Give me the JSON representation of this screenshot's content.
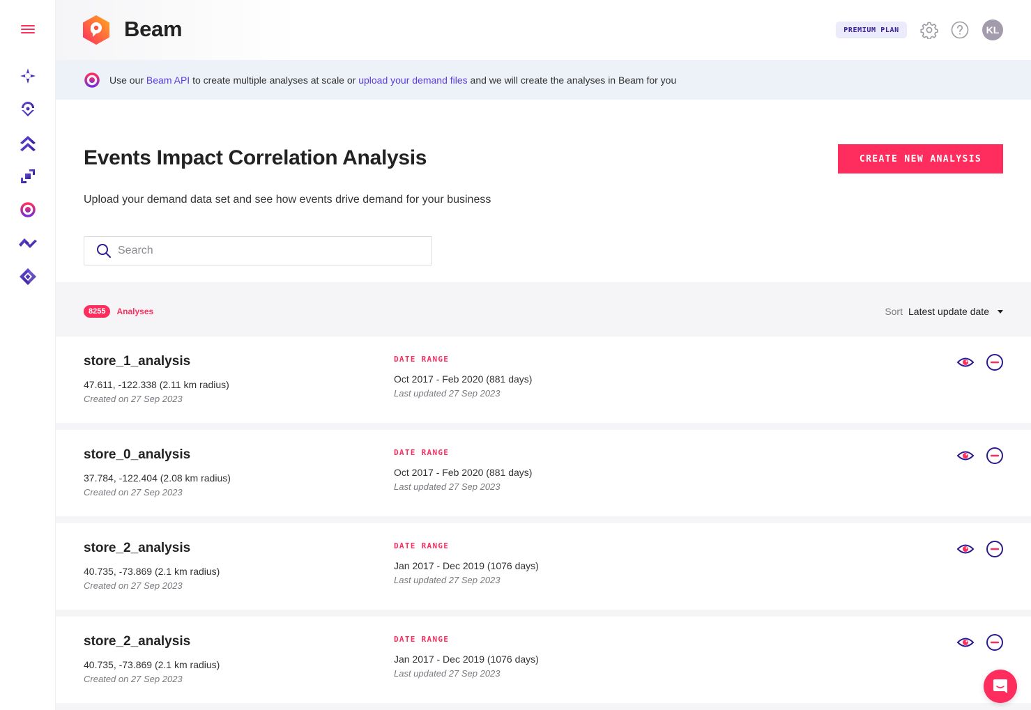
{
  "app": {
    "brand": "Beam",
    "plan_badge": "PREMIUM PLAN",
    "avatar_initials": "KL",
    "accent_color": "#ff2d5e",
    "primary_color": "#3a1f9b"
  },
  "sidebar": {
    "items": [
      {
        "name": "sidebar-item-sparkle",
        "icon": "sparkle-icon"
      },
      {
        "name": "sidebar-item-location",
        "icon": "location-pin-icon"
      },
      {
        "name": "sidebar-item-chevrons",
        "icon": "double-chevron-up-icon"
      },
      {
        "name": "sidebar-item-layers",
        "icon": "layers-icon"
      },
      {
        "name": "sidebar-item-target",
        "icon": "target-icon"
      },
      {
        "name": "sidebar-item-wave",
        "icon": "wave-icon"
      },
      {
        "name": "sidebar-item-diamond",
        "icon": "diamond-icon"
      }
    ]
  },
  "banner": {
    "text_1": "Use our ",
    "link_1": "Beam API",
    "text_2": " to create multiple analyses at scale or ",
    "link_2": "upload your demand files",
    "text_3": " and we will create the analyses in Beam for you"
  },
  "page": {
    "title": "Events Impact Correlation Analysis",
    "subtitle": "Upload your demand data set and see how events drive demand for your business",
    "create_button": "CREATE NEW ANALYSIS"
  },
  "search": {
    "placeholder": "Search",
    "value": ""
  },
  "list": {
    "count": "8255",
    "count_label": "Analyses",
    "sort_label": "Sort",
    "sort_value": "Latest update date",
    "date_range_label": "DATE RANGE",
    "items": [
      {
        "name": "store_1_analysis",
        "coords": "47.611, -122.338 (2.11 km radius)",
        "created": "Created on 27 Sep 2023",
        "date_range": "Oct 2017 - Feb 2020 (881 days)",
        "updated": "Last updated 27 Sep 2023"
      },
      {
        "name": "store_0_analysis",
        "coords": "37.784, -122.404 (2.08 km radius)",
        "created": "Created on 27 Sep 2023",
        "date_range": "Oct 2017 - Feb 2020 (881 days)",
        "updated": "Last updated 27 Sep 2023"
      },
      {
        "name": "store_2_analysis",
        "coords": "40.735, -73.869 (2.1 km radius)",
        "created": "Created on 27 Sep 2023",
        "date_range": "Jan 2017 - Dec 2019 (1076 days)",
        "updated": "Last updated 27 Sep 2023"
      },
      {
        "name": "store_2_analysis",
        "coords": "40.735, -73.869 (2.1 km radius)",
        "created": "Created on 27 Sep 2023",
        "date_range": "Jan 2017 - Dec 2019 (1076 days)",
        "updated": "Last updated 27 Sep 2023"
      }
    ]
  }
}
